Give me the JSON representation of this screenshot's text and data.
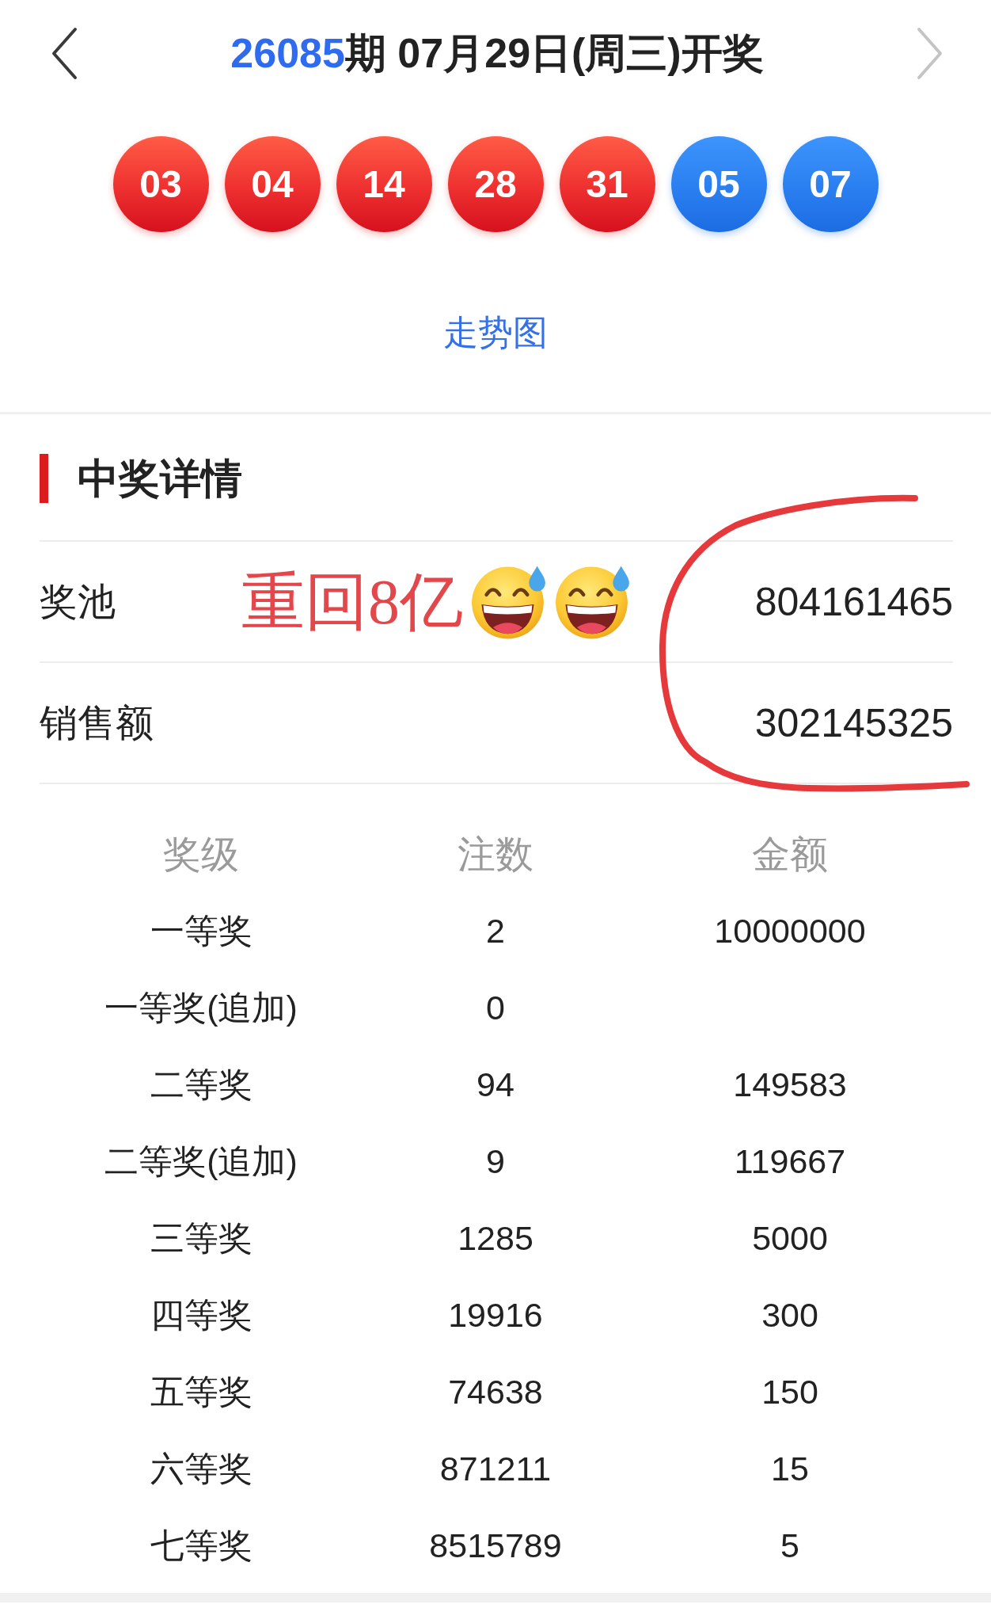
{
  "nav": [
    {
      "kind": "prev",
      "disabled": false
    },
    {
      "kind": "next",
      "disabled": true
    }
  ],
  "title": {
    "issue": "26085",
    "text": "期 07月29日(周三)开奖"
  },
  "balls": [
    {
      "number": "03",
      "kind": "front"
    },
    {
      "number": "04",
      "kind": "front"
    },
    {
      "number": "14",
      "kind": "front"
    },
    {
      "number": "28",
      "kind": "front"
    },
    {
      "number": "31",
      "kind": "front"
    },
    {
      "number": "05",
      "kind": "back"
    },
    {
      "number": "07",
      "kind": "back"
    }
  ],
  "trend_link": "走势图",
  "details": {
    "heading": "中奖详情",
    "summary_rows": [
      {
        "label": "奖池",
        "value": "804161465",
        "annotation": {
          "text": "重回8亿",
          "emojis": [
            {
              "kind": "grin_sweat"
            },
            {
              "kind": "grin_sweat"
            }
          ]
        }
      },
      {
        "label": "销售额",
        "value": "302145325"
      }
    ],
    "table": {
      "columns": [
        "奖级",
        "注数",
        "金额"
      ],
      "rows": [
        {
          "prize": "一等奖",
          "winners": "2",
          "amount": "10000000"
        },
        {
          "prize": "一等奖(追加)",
          "winners": "0"
        },
        {
          "prize": "二等奖",
          "winners": "94",
          "amount": "149583"
        },
        {
          "prize": "二等奖(追加)",
          "winners": "9",
          "amount": "119667"
        },
        {
          "prize": "三等奖",
          "winners": "1285",
          "amount": "5000"
        },
        {
          "prize": "四等奖",
          "winners": "19916",
          "amount": "300"
        },
        {
          "prize": "五等奖",
          "winners": "74638",
          "amount": "150"
        },
        {
          "prize": "六等奖",
          "winners": "871211",
          "amount": "15"
        },
        {
          "prize": "七等奖",
          "winners": "8515789",
          "amount": "5"
        }
      ]
    }
  }
}
